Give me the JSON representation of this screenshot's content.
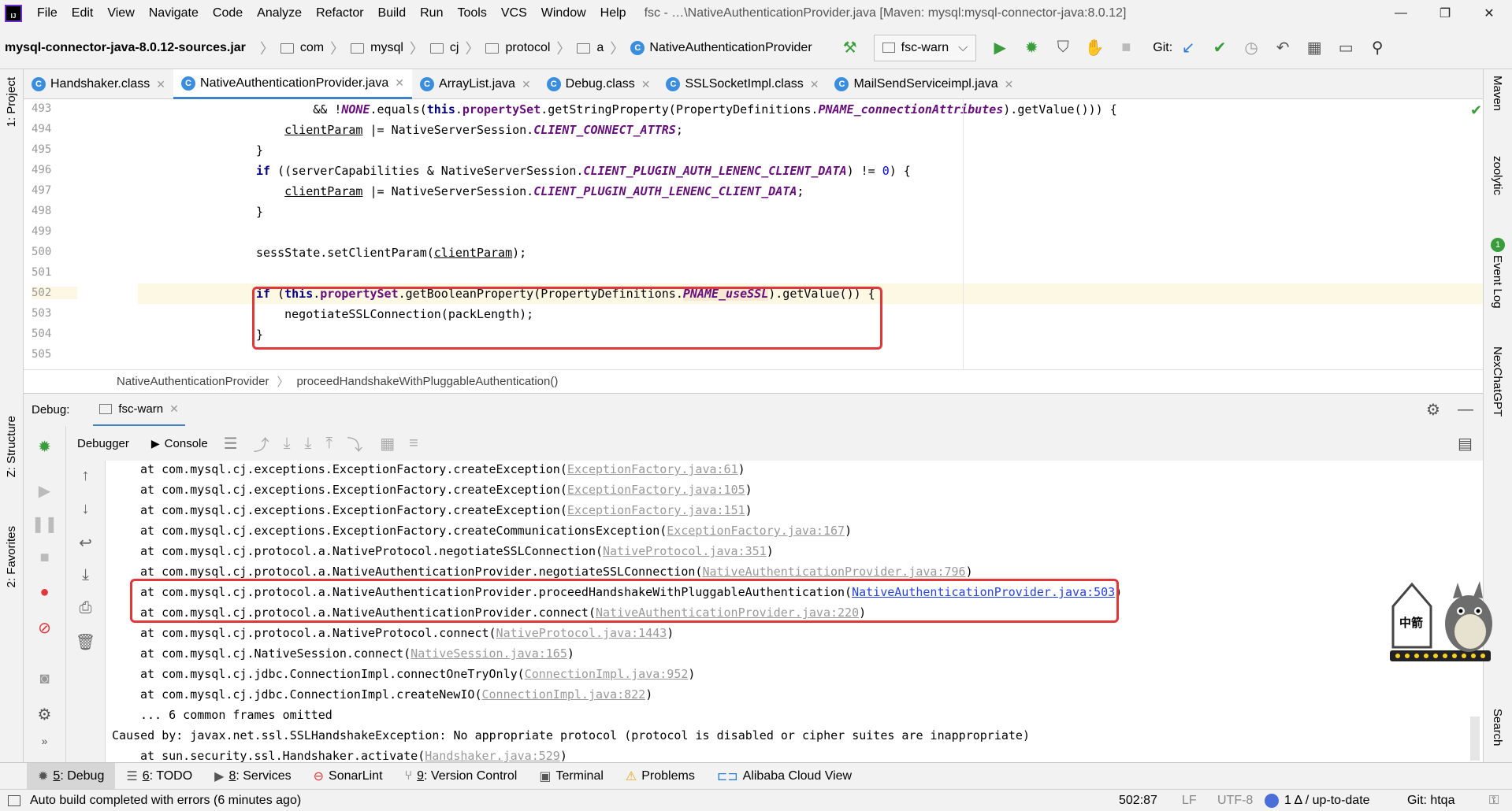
{
  "app": {
    "menu": [
      "File",
      "Edit",
      "View",
      "Navigate",
      "Code",
      "Analyze",
      "Refactor",
      "Build",
      "Run",
      "Tools",
      "VCS",
      "Window",
      "Help"
    ],
    "window_title": "fsc - …\\NativeAuthenticationProvider.java [Maven: mysql:mysql-connector-java:8.0.12]",
    "window_controls": {
      "minimize": "—",
      "restore": "❐",
      "close": "✕"
    }
  },
  "navbar": {
    "jar": "mysql-connector-java-8.0.12-sources.jar",
    "crumbs": [
      "com",
      "mysql",
      "cj",
      "protocol",
      "a"
    ],
    "class": "NativeAuthenticationProvider",
    "run_config": "fsc-warn",
    "git_label": "Git:"
  },
  "tabs": [
    {
      "label": "Handshaker.class",
      "icon": "C",
      "active": false
    },
    {
      "label": "NativeAuthenticationProvider.java",
      "icon": "C",
      "active": true
    },
    {
      "label": "ArrayList.java",
      "icon": "C",
      "active": false
    },
    {
      "label": "Debug.class",
      "icon": "C",
      "active": false
    },
    {
      "label": "SSLSocketImpl.class",
      "icon": "C",
      "active": false
    },
    {
      "label": "MailSendServiceimpl.java",
      "icon": "C",
      "active": false
    }
  ],
  "left_strip": {
    "project": "1: Project",
    "structure": "Z: Structure",
    "favorites": "2: Favorites"
  },
  "right_strip": {
    "maven": "Maven",
    "zoolytic": "zoolytic",
    "event_log": "Event Log",
    "event_count": "1",
    "nexchat": "NexChatGPT",
    "search": "Search"
  },
  "editor": {
    "line_numbers": [
      "493",
      "494",
      "495",
      "496",
      "497",
      "498",
      "499",
      "500",
      "501",
      "502",
      "503",
      "504",
      "505"
    ],
    "lines": {
      "l493a": "        && !",
      "l493b": "NONE",
      "l493c": ".equals(",
      "l493d": "this",
      "l493e": ".",
      "l493f": "propertySet",
      "l493g": ".getStringProperty(PropertyDefinitions.",
      "l493h": "PNAME_connectionAttributes",
      "l493i": ").getValue())) {",
      "l494a": "    ",
      "l494b": "clientParam",
      "l494c": " |= NativeServerSession.",
      "l494d": "CLIENT_CONNECT_ATTRS",
      "l494e": ";",
      "l495": "}",
      "l496a": "if",
      "l496b": " ((serverCapabilities & NativeServerSession.",
      "l496c": "CLIENT_PLUGIN_AUTH_LENENC_CLIENT_DATA",
      "l496d": ") != ",
      "l496e": "0",
      "l496f": ") {",
      "l497a": "    ",
      "l497b": "clientParam",
      "l497c": " |= NativeServerSession.",
      "l497d": "CLIENT_PLUGIN_AUTH_LENENC_CLIENT_DATA",
      "l497e": ";",
      "l498": "}",
      "l500a": "sessState.setClientParam(",
      "l500b": "clientParam",
      "l500c": ");",
      "l502a": "if",
      "l502b": " (",
      "l502c": "this",
      "l502d": ".",
      "l502e": "propertySet",
      "l502f": ".getBooleanProperty(PropertyDefinitions.",
      "l502g": "PNAME_useSSL",
      "l502h": ").getValue()) {",
      "l503": "    negotiateSSLConnection(packLength);",
      "l504": "}"
    },
    "breadcrumb": {
      "class": "NativeAuthenticationProvider",
      "method": "proceedHandshakeWithPluggableAuthentication()"
    }
  },
  "debug": {
    "label": "Debug:",
    "session": "fsc-warn",
    "tabs": {
      "debugger": "Debugger",
      "console": "Console"
    },
    "trace": [
      {
        "text": "at com.mysql.cj.exceptions.ExceptionFactory.createException(",
        "link": "ExceptionFactory.java:61",
        "tail": ")",
        "active": false
      },
      {
        "text": "at com.mysql.cj.exceptions.ExceptionFactory.createException(",
        "link": "ExceptionFactory.java:105",
        "tail": ")",
        "active": false
      },
      {
        "text": "at com.mysql.cj.exceptions.ExceptionFactory.createException(",
        "link": "ExceptionFactory.java:151",
        "tail": ")",
        "active": false
      },
      {
        "text": "at com.mysql.cj.exceptions.ExceptionFactory.createCommunicationsException(",
        "link": "ExceptionFactory.java:167",
        "tail": ")",
        "active": false
      },
      {
        "text": "at com.mysql.cj.protocol.a.NativeProtocol.negotiateSSLConnection(",
        "link": "NativeProtocol.java:351",
        "tail": ")",
        "active": false
      },
      {
        "text": "at com.mysql.cj.protocol.a.NativeAuthenticationProvider.negotiateSSLConnection(",
        "link": "NativeAuthenticationProvider.java:796",
        "tail": ")",
        "active": false
      },
      {
        "text": "at com.mysql.cj.protocol.a.NativeAuthenticationProvider.proceedHandshakeWithPluggableAuthentication(",
        "link": "NativeAuthenticationProvider.java:503",
        "tail": ")",
        "active": true
      },
      {
        "text": "at com.mysql.cj.protocol.a.NativeAuthenticationProvider.connect(",
        "link": "NativeAuthenticationProvider.java:220",
        "tail": ")",
        "active": false
      },
      {
        "text": "at com.mysql.cj.protocol.a.NativeProtocol.connect(",
        "link": "NativeProtocol.java:1443",
        "tail": ")",
        "active": false
      },
      {
        "text": "at com.mysql.cj.NativeSession.connect(",
        "link": "NativeSession.java:165",
        "tail": ")",
        "active": false
      },
      {
        "text": "at com.mysql.cj.jdbc.ConnectionImpl.connectOneTryOnly(",
        "link": "ConnectionImpl.java:952",
        "tail": ")",
        "active": false
      },
      {
        "text": "at com.mysql.cj.jdbc.ConnectionImpl.createNewIO(",
        "link": "ConnectionImpl.java:822",
        "tail": ")",
        "active": false
      }
    ],
    "omitted": "... 6 common frames omitted",
    "caused_by": "Caused by: javax.net.ssl.SSLHandshakeException: No appropriate protocol (protocol is disabled or cipher suites are inappropriate)",
    "last_line": {
      "text": "at sun.security.ssl.Handshaker.activate(",
      "link": "Handshaker.java:529",
      "tail": ")"
    }
  },
  "bottom_tools": [
    {
      "num": "5",
      "label": ": Debug",
      "icon": "bug-icon",
      "active": true
    },
    {
      "num": "6",
      "label": ": TODO",
      "icon": "list-icon",
      "active": false
    },
    {
      "num": "8",
      "label": ": Services",
      "icon": "services-icon",
      "active": false
    },
    {
      "num": "",
      "label": "SonarLint",
      "icon": "sonarlint-icon",
      "active": false
    },
    {
      "num": "9",
      "label": ": Version Control",
      "icon": "vcs-icon",
      "active": false
    },
    {
      "num": "",
      "label": "Terminal",
      "icon": "terminal-icon",
      "active": false
    },
    {
      "num": "",
      "label": "Problems",
      "icon": "warning-icon",
      "active": false
    },
    {
      "num": "",
      "label": "Alibaba Cloud View",
      "icon": "alibaba-icon",
      "active": false
    }
  ],
  "status": {
    "message": "Auto build completed with errors (6 minutes ago)",
    "position": "502:87",
    "line_sep": "LF",
    "encoding": "UTF-8",
    "vcs": "1 Δ / up-to-date",
    "git": "Git: htqa"
  },
  "mascot": {
    "text": "中箭"
  },
  "colors": {
    "accent": "#4083c9",
    "highlight_box": "#e0373b",
    "keyword": "#000080",
    "field": "#660e7a",
    "run_green": "#3a9c3a"
  }
}
